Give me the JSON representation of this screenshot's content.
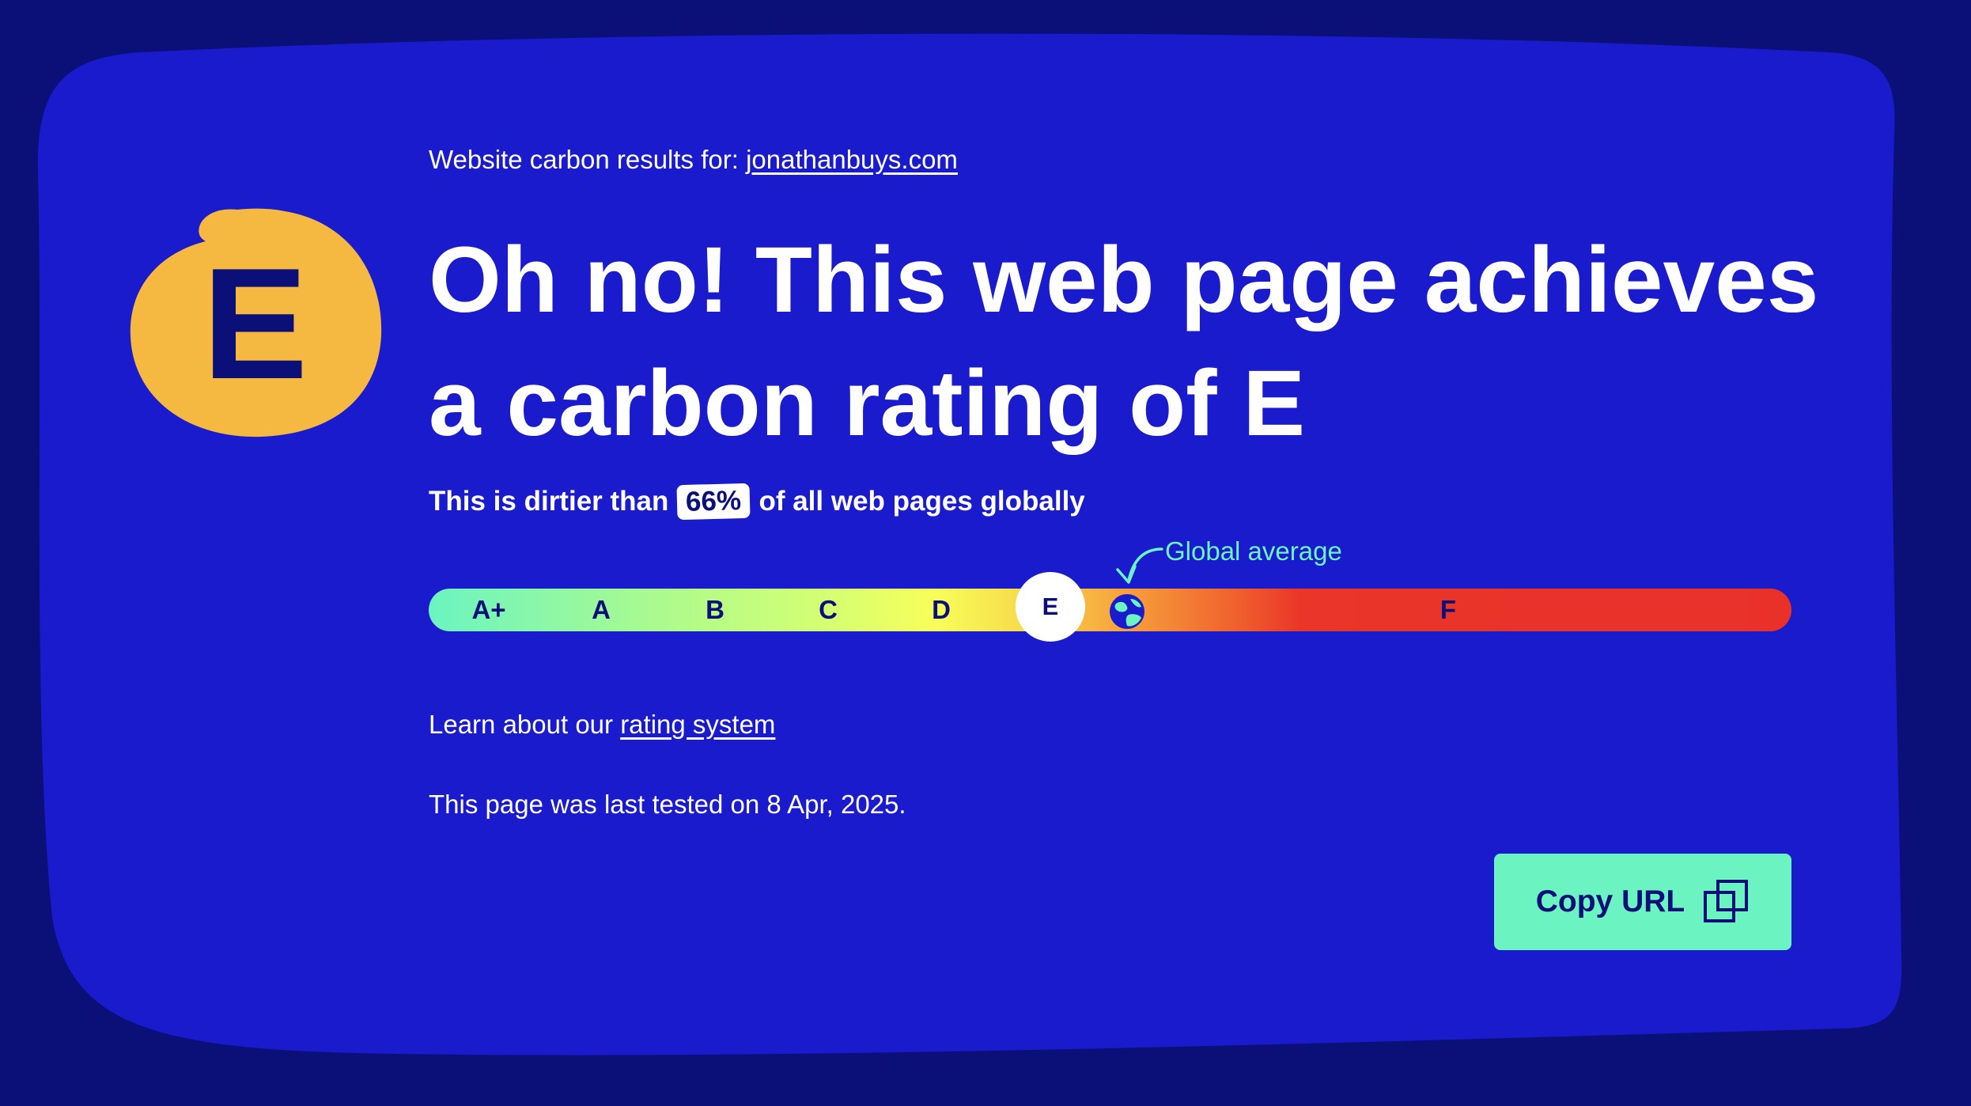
{
  "colors": {
    "page_background": "#0b0f78",
    "card_background": "#1a1bcc",
    "grade_blob": "#f5b841",
    "accent_mint": "#6bf4c1",
    "text_dark": "#0b0f78",
    "text_light": "#ffffff",
    "bad_red": "#e9312a"
  },
  "grade": {
    "letter": "E"
  },
  "results": {
    "prefix": "Website carbon results for:",
    "site": "jonathanbuys.com"
  },
  "headline": "Oh no! This web page achieves a carbon rating of E",
  "comparison": {
    "before": "This is dirtier than",
    "percent": "66%",
    "after": "of all web pages globally"
  },
  "scale": {
    "grades": [
      "A+",
      "A",
      "B",
      "C",
      "D",
      "E",
      "F"
    ],
    "current_grade": "E",
    "global_average_label": "Global average",
    "global_average_icon": "globe-icon"
  },
  "learn": {
    "prefix": "Learn about our",
    "link": "rating system"
  },
  "last_tested": "This page was last tested on 8 Apr, 2025.",
  "copy_button": {
    "label": "Copy URL",
    "icon": "copy-icon"
  }
}
